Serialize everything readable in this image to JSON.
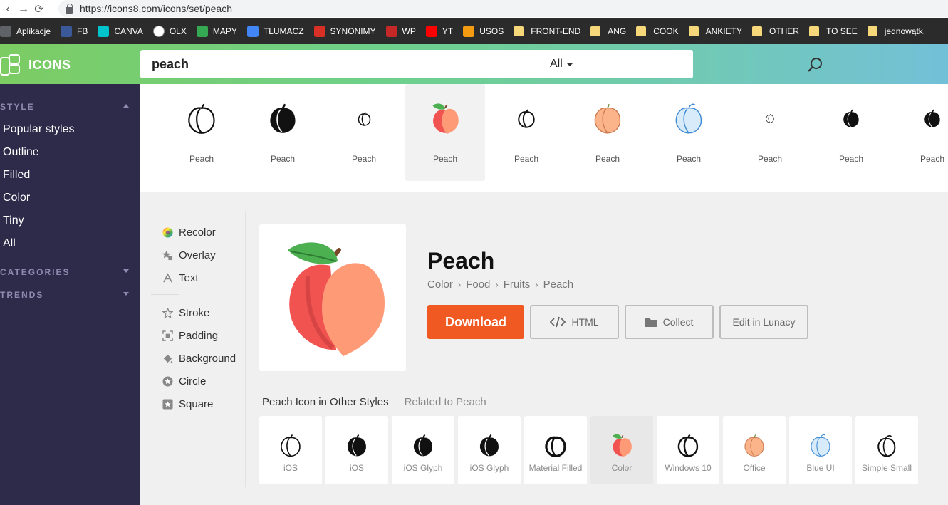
{
  "browser": {
    "url": "https://icons8.com/icons/set/peach",
    "bookmarks": [
      {
        "label": "Aplikacje",
        "icon": "apps-icon",
        "color": "#5f6368"
      },
      {
        "label": "FB",
        "icon": "facebook-icon",
        "color": "#3b5998"
      },
      {
        "label": "CANVA",
        "icon": "canva-icon",
        "color": "#00c4cc"
      },
      {
        "label": "OLX",
        "icon": "olx-icon",
        "color": "#ffffff"
      },
      {
        "label": "MAPY",
        "icon": "maps-icon",
        "color": "#34a853"
      },
      {
        "label": "TŁUMACZ",
        "icon": "translate-icon",
        "color": "#4285f4"
      },
      {
        "label": "SYNONIMY",
        "icon": "synonimy-icon",
        "color": "#d93025"
      },
      {
        "label": "WP",
        "icon": "wp-icon",
        "color": "#c62828"
      },
      {
        "label": "YT",
        "icon": "youtube-icon",
        "color": "#ff0000"
      },
      {
        "label": "USOS",
        "icon": "usos-icon",
        "color": "#f39c12"
      },
      {
        "label": "FRONT-END",
        "icon": "folder-icon",
        "color": "#f6d77a"
      },
      {
        "label": "ANG",
        "icon": "folder-icon",
        "color": "#f6d77a"
      },
      {
        "label": "COOK",
        "icon": "folder-icon",
        "color": "#f6d77a"
      },
      {
        "label": "ANKIETY",
        "icon": "folder-icon",
        "color": "#f6d77a"
      },
      {
        "label": "OTHER",
        "icon": "folder-icon",
        "color": "#f6d77a"
      },
      {
        "label": "TO SEE",
        "icon": "folder-icon",
        "color": "#f6d77a"
      },
      {
        "label": "jednowątk.",
        "icon": "folder-icon",
        "color": "#f6d77a"
      }
    ]
  },
  "header": {
    "logo": "ICONS",
    "search_value": "peach",
    "search_filter": "All"
  },
  "sidebar": {
    "style_heading": "STYLE",
    "style_items": [
      "Popular styles",
      "Outline",
      "Filled",
      "Color",
      "Tiny",
      "All"
    ],
    "categories_heading": "CATEGORIES",
    "trends_heading": "TRENDS"
  },
  "strip": [
    {
      "label": "Peach",
      "style": "outline"
    },
    {
      "label": "Peach",
      "style": "filled"
    },
    {
      "label": "Peach",
      "style": "tiny-outline"
    },
    {
      "label": "Peach",
      "style": "color",
      "selected": true
    },
    {
      "label": "Peach",
      "style": "small-outline"
    },
    {
      "label": "Peach",
      "style": "office"
    },
    {
      "label": "Peach",
      "style": "blue-ui"
    },
    {
      "label": "Peach",
      "style": "micro"
    },
    {
      "label": "Peach",
      "style": "small-filled"
    },
    {
      "label": "Peach",
      "style": "small-filled"
    }
  ],
  "tools": [
    {
      "label": "Recolor",
      "icon": "recolor-icon"
    },
    {
      "label": "Overlay",
      "icon": "overlay-icon"
    },
    {
      "label": "Text",
      "icon": "text-icon"
    },
    {
      "label": "Stroke",
      "icon": "stroke-icon"
    },
    {
      "label": "Padding",
      "icon": "padding-icon"
    },
    {
      "label": "Background",
      "icon": "background-icon"
    },
    {
      "label": "Circle",
      "icon": "circle-icon"
    },
    {
      "label": "Square",
      "icon": "square-icon"
    }
  ],
  "detail": {
    "title": "Peach",
    "breadcrumb": [
      "Color",
      "Food",
      "Fruits",
      "Peach"
    ],
    "download": "Download",
    "html": "HTML",
    "collect": "Collect",
    "lunacy": "Edit in Lunacy"
  },
  "tabs": {
    "other_styles": "Peach Icon in Other Styles",
    "related": "Related to Peach"
  },
  "styles": [
    {
      "label": "iOS",
      "style": "outline"
    },
    {
      "label": "iOS",
      "style": "filled"
    },
    {
      "label": "iOS Glyph",
      "style": "filled"
    },
    {
      "label": "iOS Glyph",
      "style": "filled"
    },
    {
      "label": "Material Filled",
      "style": "material"
    },
    {
      "label": "Color",
      "style": "color",
      "selected": true
    },
    {
      "label": "Windows 10",
      "style": "outline-bold"
    },
    {
      "label": "Office",
      "style": "office"
    },
    {
      "label": "Blue UI",
      "style": "blue-ui"
    },
    {
      "label": "Simple Small",
      "style": "simple"
    }
  ],
  "colors": {
    "download": "#f05a22",
    "sidebar": "#2e2a4a",
    "peach_light": "#ff9a76",
    "peach_red": "#f05350",
    "leaf": "#4caf50"
  }
}
